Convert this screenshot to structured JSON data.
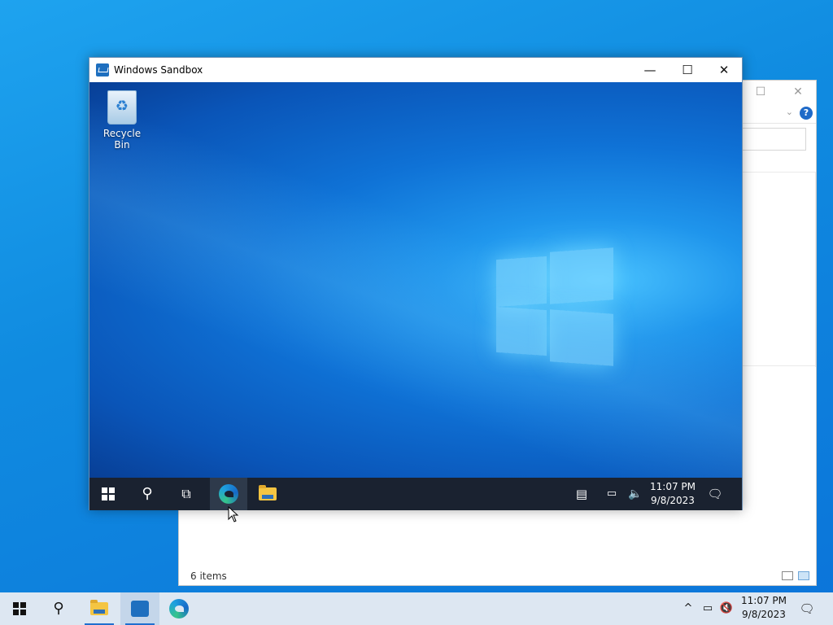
{
  "sandbox_window": {
    "title": "Windows Sandbox",
    "minimize_glyph": "—",
    "maximize_glyph": "☐",
    "close_glyph": "✕",
    "desktop": {
      "icons": [
        {
          "label": "Recycle Bin",
          "icon": "recycle-bin-icon"
        }
      ]
    },
    "taskbar": {
      "items": [
        "start-icon",
        "search-icon",
        "task-view-icon",
        "edge-icon",
        "file-explorer-icon"
      ],
      "clock_time": "11:07 PM",
      "clock_date": "9/8/2023"
    }
  },
  "explorer_window": {
    "status_text": "6 items",
    "help_glyph": "?",
    "chevron_glyph": "⌄",
    "maximize_glyph": "☐",
    "close_glyph": "✕"
  },
  "host_taskbar": {
    "items": [
      "start-icon",
      "search-icon",
      "file-explorer-icon",
      "windows-sandbox-icon",
      "edge-icon"
    ],
    "clock_time": "11:07 PM",
    "clock_date": "9/8/2023",
    "tray_chevron_glyph": "^"
  },
  "colors": {
    "accent": "#1f6fcf",
    "sandbox_taskbar": "#1a2230",
    "host_taskbar": "#dde7f2"
  }
}
